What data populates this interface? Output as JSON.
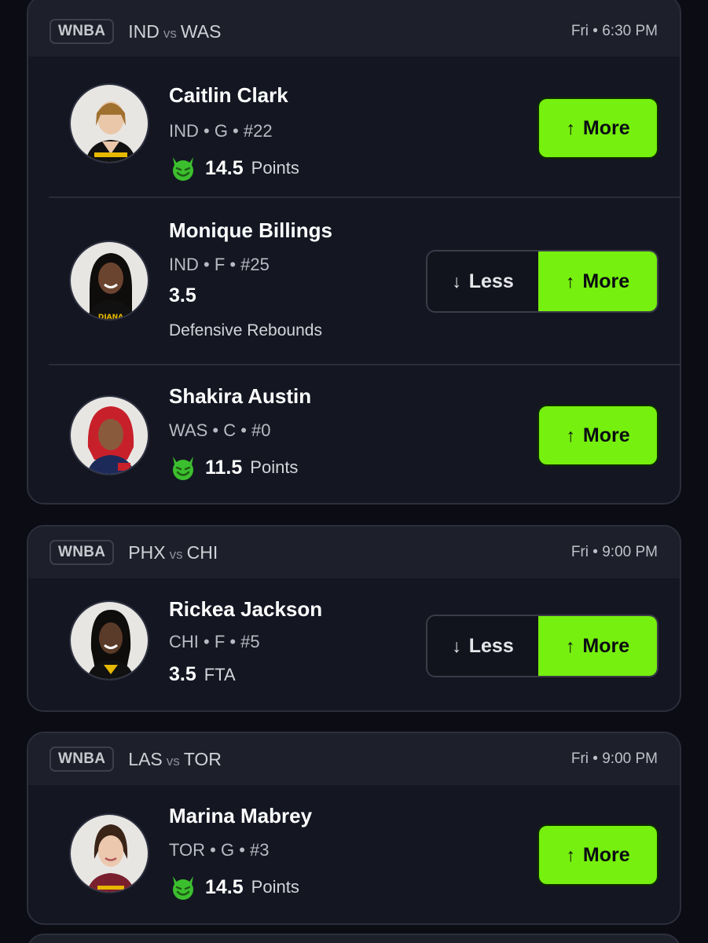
{
  "colors": {
    "accent": "#76f00e",
    "background": "#0b0c14",
    "card": "#141722",
    "header": "#1d202b"
  },
  "games": [
    {
      "league": "WNBA",
      "home": "IND",
      "vs": "vs",
      "away": "WAS",
      "time": "Fri • 6:30 PM",
      "players": [
        {
          "name": "Caitlin Clark",
          "meta": "IND • G • #22",
          "value": "14.5",
          "stat": "Points",
          "icon": "devil-emoji-icon",
          "more": "More",
          "less": null
        },
        {
          "name": "Monique Billings",
          "meta": "IND • F • #25",
          "value": "3.5",
          "stat": "Defensive Rebounds",
          "icon": null,
          "more": "More",
          "less": "Less"
        },
        {
          "name": "Shakira Austin",
          "meta": "WAS • C • #0",
          "value": "11.5",
          "stat": "Points",
          "icon": "devil-emoji-icon",
          "more": "More",
          "less": null
        }
      ]
    },
    {
      "league": "WNBA",
      "home": "PHX",
      "vs": "vs",
      "away": "CHI",
      "time": "Fri • 9:00 PM",
      "players": [
        {
          "name": "Rickea Jackson",
          "meta": "CHI • F • #5",
          "value": "3.5",
          "stat": "FTA",
          "icon": null,
          "more": "More",
          "less": "Less"
        }
      ]
    },
    {
      "league": "WNBA",
      "home": "LAS",
      "vs": "vs",
      "away": "TOR",
      "time": "Fri • 9:00 PM",
      "players": [
        {
          "name": "Marina Mabrey",
          "meta": "TOR • G • #3",
          "value": "14.5",
          "stat": "Points",
          "icon": "devil-emoji-icon",
          "more": "More",
          "less": null
        }
      ]
    }
  ]
}
